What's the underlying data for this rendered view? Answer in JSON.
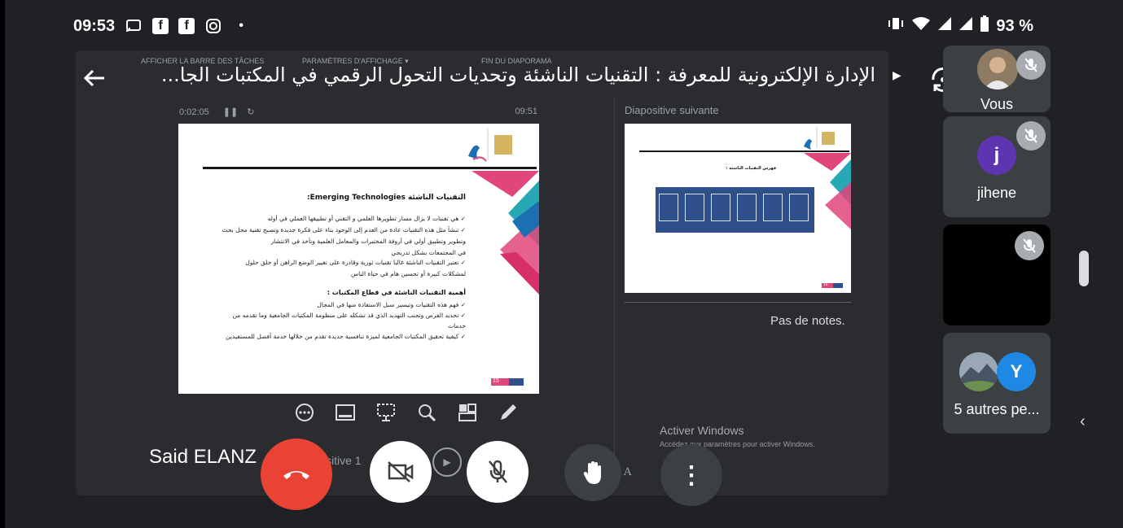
{
  "status": {
    "time": "09:53",
    "battery": "93 %",
    "icons": [
      "cast-icon",
      "facebook-icon",
      "facebook-icon",
      "instagram-icon",
      "dot-icon"
    ],
    "right_icons": [
      "vibrate-icon",
      "wifi-icon",
      "signal-icon",
      "signal-icon",
      "battery-icon"
    ]
  },
  "meeting": {
    "title": "الإدارة الإلكترونية للمعرفة : التقنيات الناشئة وتحديات التحول الرقمي في المكتبات الجا..."
  },
  "presenter": {
    "elapsed": "0:02:05",
    "clock": "09:51",
    "bar_items": [
      "AFFICHER LA BARRE DES TÂCHES",
      "PARAMÈTRES D'AFFICHAGE ▾",
      "FIN DU DIAPORAMA"
    ],
    "next_slide_label": "Diapositive suivante",
    "notes": "Pas de notes.",
    "activate_windows_title": "Activer Windows",
    "activate_windows_sub": "Accédez aux paramètres pour activer Windows.",
    "diapo_partial": "sitive 1",
    "speaker_name": "Said ELANZ",
    "font_buttons": "A A"
  },
  "slide": {
    "heading": "التقنيات الناشئة Emerging Technologies:",
    "lines": [
      "✓ هي تقنيات لا يزال مسار تطويرها العلمي و التقني أو تطبيقها العملي في أوله",
      "✓ تنشأ مثل هذه التقنيات عادة من العدم إلى الوجود بناء على فكرة جديدة وتصبح تقنية محل بحث",
      "وتطوير وتطبيق أولي في أروقة المختبرات والمعامل العلمية وتأخذ في الانتشار",
      "في المجتمعات بشكل تدريجي",
      "✓ تعتبر التقنيات الناشئة غالبا تقنيات ثورية وقادرة على تغيير الوضع الراهن أو خلق حلول",
      "لمشكلات كبيرة أو تحسين هام في حياة الناس"
    ],
    "subheading": "أهمية التقنيات الناشئة في قطاع المكتبات :",
    "lines2": [
      "✓ فهم هذه التقنيات وتيسير سبل الاستفادة منها في المجال",
      "✓ تحديد الفرص وتجنب التهديد الذي قد تشكله على منظومة المكتبات الجامعية وما تقدمه من",
      "خدمات",
      "✓ كيفية تحقيق المكتبات الجامعية لميزة تنافسية جديدة تقدم من خلالها خدمة أفضل للمستفيدين"
    ],
    "page": "15"
  },
  "next_slide": {
    "heading": "فهرس التقنيات الناشئة :",
    "page": "16"
  },
  "participants": [
    {
      "name": "Vous",
      "muted": true
    },
    {
      "name": "jihene",
      "initial": "j",
      "color": "#5e35b1",
      "muted": true
    },
    {
      "name": "",
      "muted": true
    },
    {
      "name": "5 autres pe...",
      "initial": "Y",
      "color": "#1e88e5"
    }
  ],
  "colors": {
    "end_call": "#ea4335",
    "tile_bg": "#3c4043",
    "accent_pink": "#e0457b",
    "accent_teal": "#27a9b5"
  }
}
